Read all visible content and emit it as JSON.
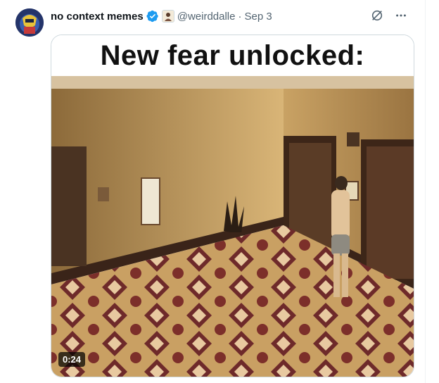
{
  "post": {
    "display_name": "no context memes",
    "handle": "@weirddalle",
    "separator": "·",
    "date": "Sep 3"
  },
  "media": {
    "caption": "New fear unlocked:",
    "duration": "0:24"
  },
  "icons": {
    "verified": "verified-badge-icon",
    "affiliate": "affiliate-badge-icon",
    "grok": "grok-icon",
    "more": "more-icon"
  },
  "colors": {
    "verified_blue": "#1d9bf0",
    "text_primary": "#0f1419",
    "text_secondary": "#536471"
  }
}
